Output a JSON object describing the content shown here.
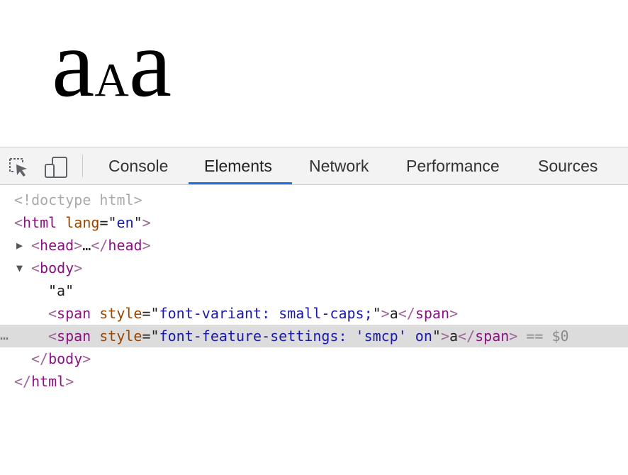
{
  "preview": {
    "char1": "a",
    "char2": "a",
    "char3": "a"
  },
  "toolbar": {
    "icons": [
      "inspect-element-icon",
      "device-toolbar-icon"
    ],
    "tabs": [
      {
        "label": "Console"
      },
      {
        "label": "Elements"
      },
      {
        "label": "Network"
      },
      {
        "label": "Performance"
      },
      {
        "label": "Sources"
      }
    ],
    "active_tab": "Elements",
    "accent_color": "#1a73e8"
  },
  "dom": {
    "doctype": "<!doctype html>",
    "html_open": {
      "tag": "html",
      "attr": "lang",
      "value": "en"
    },
    "head": {
      "tag": "head",
      "ellipsis": "…",
      "collapsed": true
    },
    "body": {
      "tag": "body",
      "expanded": true
    },
    "text_node": "a",
    "span1": {
      "tag": "span",
      "attr": "style",
      "value": "font-variant: small-caps;",
      "text": "a"
    },
    "span2": {
      "tag": "span",
      "attr": "style",
      "value": "font-feature-settings: 'smcp' on",
      "text": "a",
      "selected_marker": "== $0"
    },
    "body_close": "body",
    "html_close": "html"
  }
}
